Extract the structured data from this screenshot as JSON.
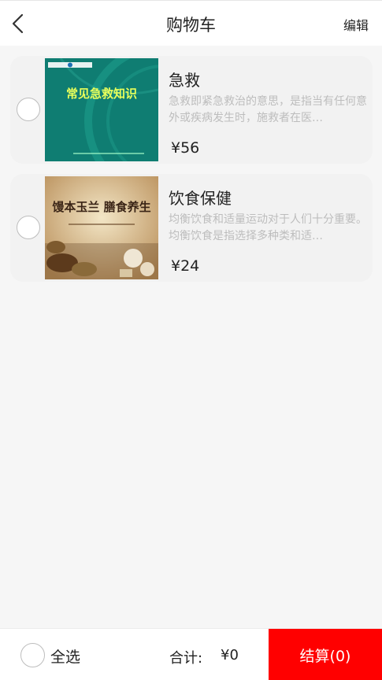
{
  "header": {
    "title": "购物车",
    "edit_label": "编辑"
  },
  "items": [
    {
      "title": "急救",
      "description": "急救即紧急救治的意思，是指当有任何意外或疾病发生时，施救者在医…",
      "price": "¥56",
      "thumbnail_text": "常见急救知识"
    },
    {
      "title": "饮食保健",
      "description": "均衡饮食和适量运动对于人们十分重要。均衡饮食是指选择多种类和适…",
      "price": "¥24",
      "thumbnail_text": "馒本玉兰 膳食养生"
    }
  ],
  "footer": {
    "select_all_label": "全选",
    "total_label": "合计:",
    "total_value": "¥0",
    "checkout_label": "结算(0)"
  },
  "colors": {
    "accent": "#ff0000",
    "muted_text": "#bdbdbd",
    "card_bg": "#f2f2f2"
  }
}
